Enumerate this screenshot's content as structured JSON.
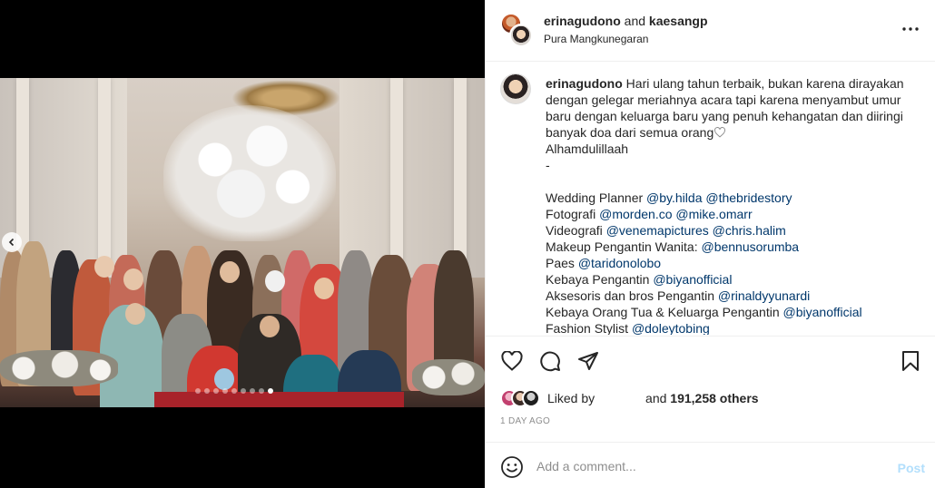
{
  "header": {
    "user1": "erinagudono",
    "and_text": "and",
    "user2": "kaesangp",
    "location": "Pura Mangkunegaran"
  },
  "post": {
    "author": "erinagudono",
    "caption_lines": [
      "Hari ulang tahun terbaik, bukan karena dirayakan",
      "dengan gelegar meriahnya acara tapi karena menyambut umur",
      "baru dengan keluarga baru yang penuh kehangatan dan diiringi",
      "banyak doa dari semua orang"
    ],
    "line_alhamdulillah": "Alhamdulillaah",
    "line_dash": "-",
    "credits": [
      {
        "label": "Wedding Planner ",
        "tags": "@by.hilda @thebridestory"
      },
      {
        "label": "Fotografi ",
        "tags": "@morden.co @mike.omarr"
      },
      {
        "label": "Videografi ",
        "tags": "@venemapictures @chris.halim"
      },
      {
        "label": "Makeup Pengantin Wanita: ",
        "tags": "@bennusorumba"
      },
      {
        "label": "Paes ",
        "tags": "@taridonolobo"
      },
      {
        "label": "Kebaya Pengantin ",
        "tags": "@biyanofficial"
      },
      {
        "label": "Aksesoris dan bros Pengantin ",
        "tags": "@rinaldyyunardi"
      },
      {
        "label": "Kebaya Orang Tua & Keluarga Pengantin ",
        "tags": "@biyanofficial"
      },
      {
        "label": "Fashion Stylist ",
        "tags": "@doleytobing"
      }
    ]
  },
  "likes": {
    "liked_by": "Liked by",
    "and_others": "and",
    "count": "191,258 others"
  },
  "time": "1 DAY AGO",
  "comment": {
    "placeholder": "Add a comment...",
    "post_label": "Post"
  },
  "carousel": {
    "total": 9,
    "active": 9
  },
  "colors": {
    "link": "#00376b",
    "post_disabled": "#b2dffc",
    "muted": "#8e8e8e",
    "divider": "#efefef"
  }
}
